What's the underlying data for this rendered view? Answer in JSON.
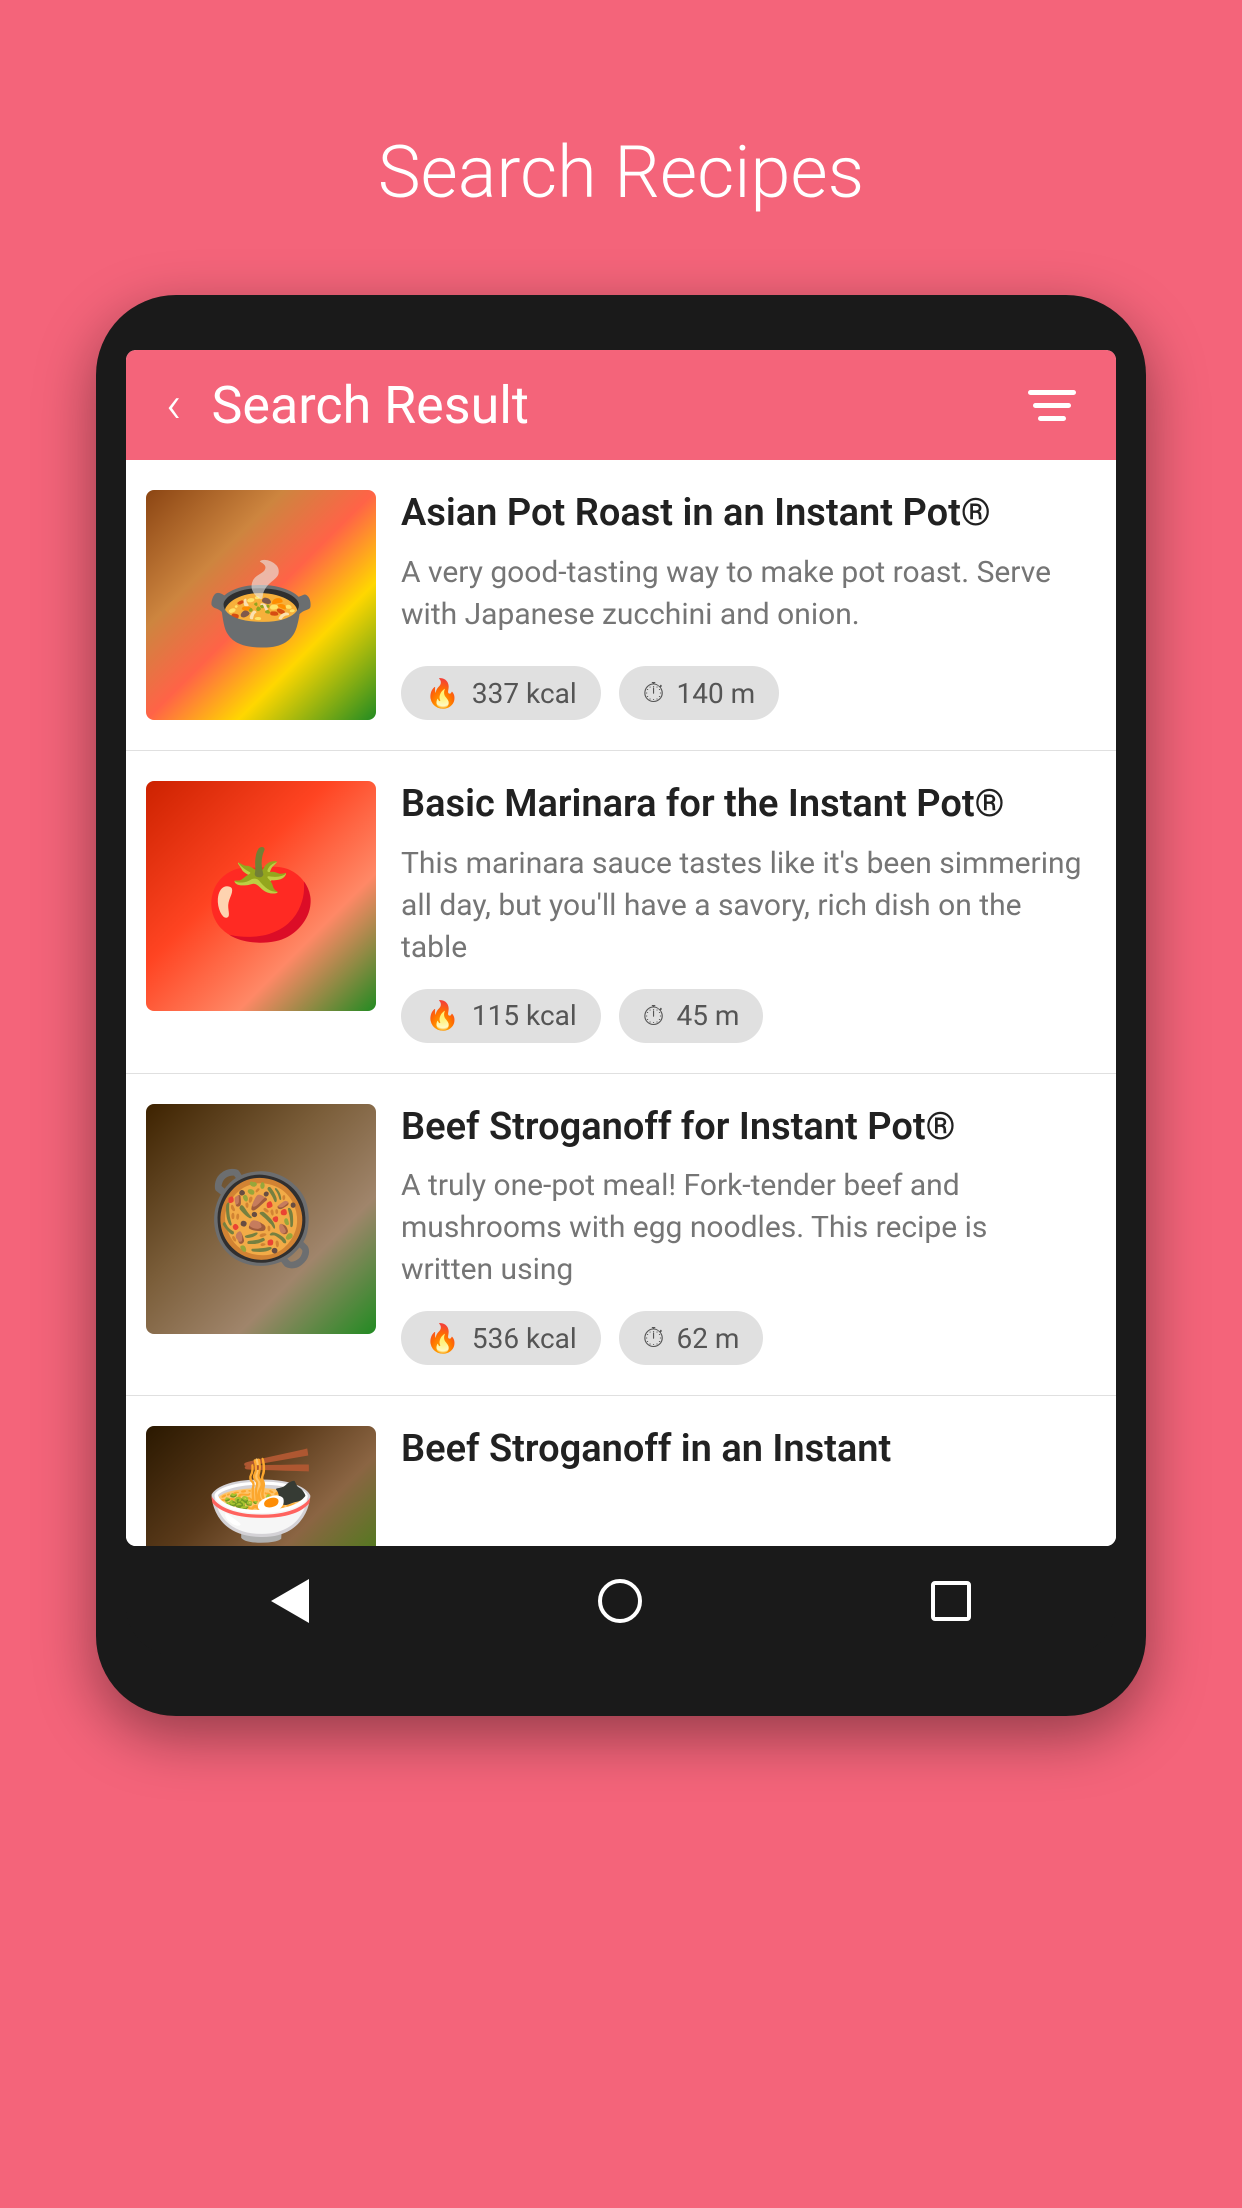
{
  "pageTitle": "Search Recipes",
  "appBar": {
    "backLabel": "‹",
    "title": "Search Result"
  },
  "recipes": [
    {
      "id": "asian-pot-roast",
      "title": "Asian Pot Roast in an Instant Pot®",
      "description": "A very good-tasting way to make pot roast. Serve with Japanese zucchini and onion.",
      "kcal": "337 kcal",
      "time": "140 m",
      "thumbClass": "thumb-asian"
    },
    {
      "id": "basic-marinara",
      "title": "Basic Marinara for the Instant Pot®",
      "description": "This marinara sauce tastes like it's been simmering all day, but you'll have a savory, rich dish on the table",
      "kcal": "115 kcal",
      "time": "45 m",
      "thumbClass": "thumb-marinara"
    },
    {
      "id": "beef-stroganoff-ip",
      "title": "Beef Stroganoff for Instant Pot®",
      "description": "A truly one-pot meal! Fork-tender beef and mushrooms with egg noodles. This recipe is written using",
      "kcal": "536 kcal",
      "time": "62 m",
      "thumbClass": "thumb-stroganoff"
    },
    {
      "id": "beef-stroganoff-instant",
      "title": "Beef Stroganoff in an Instant",
      "description": "",
      "kcal": "",
      "time": "",
      "thumbClass": "thumb-stroganoff2",
      "partial": true
    }
  ],
  "icons": {
    "flame": "🔥",
    "clock": "⏱"
  },
  "navBar": {
    "back": "back",
    "home": "home",
    "recent": "recent"
  }
}
